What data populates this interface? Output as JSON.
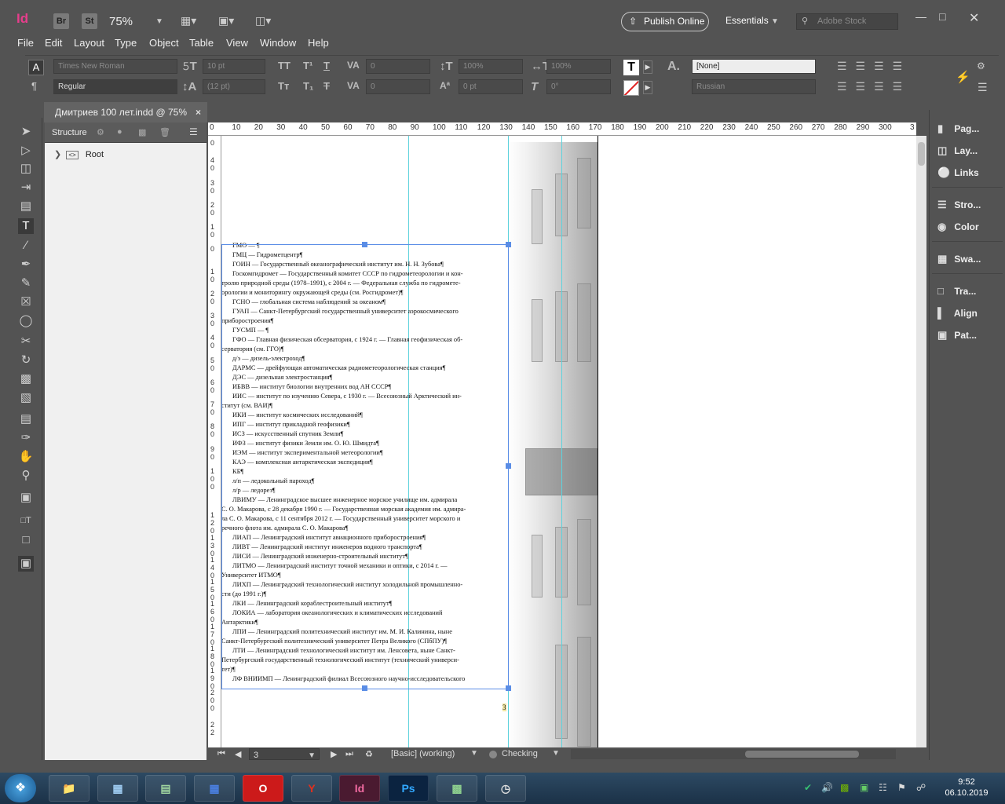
{
  "app": {
    "logo": "Id",
    "bridge": "Br",
    "stock": "St",
    "zoom": "75%",
    "publish": "Publish Online",
    "workspace": "Essentials",
    "search_placeholder": "Adobe Stock"
  },
  "menu": [
    "File",
    "Edit",
    "Layout",
    "Type",
    "Object",
    "Table",
    "View",
    "Window",
    "Help"
  ],
  "control": {
    "font_family": "Times New Roman",
    "font_style": "Regular",
    "font_size": "10 pt",
    "leading": "(12 pt)",
    "kerning": "0",
    "tracking": "0",
    "v_scale": "100%",
    "h_scale": "100%",
    "baseline": "0 pt",
    "skew": "0°",
    "char_style": "[None]",
    "language": "Russian"
  },
  "document_tab": {
    "title": "Дмитриев 100 лет.indd @ 75%",
    "close": "×"
  },
  "structure_panel": {
    "title": "Structure",
    "root": "Root"
  },
  "ruler_h": [
    "0",
    "10",
    "20",
    "30",
    "40",
    "50",
    "60",
    "70",
    "80",
    "90",
    "100",
    "110",
    "120",
    "130",
    "140",
    "150",
    "160",
    "170",
    "180",
    "190",
    "200",
    "210",
    "220",
    "230",
    "240",
    "250",
    "260",
    "270",
    "280",
    "290",
    "300",
    "3"
  ],
  "document_text": [
    {
      "t": "ГМО — ¶",
      "in": true
    },
    {
      "t": "ГМЦ — Гидрометцентр¶",
      "in": true
    },
    {
      "t": "ГОИН — Государственный океанографический институт им. Н. Н. Зубова¶",
      "in": true
    },
    {
      "t": "Госкомгидромет — Государственный комитет СССР по гидрометеорологии и кон-",
      "in": true
    },
    {
      "t": "тролю природной среды (1978–1991), с 2004 г. — Федеральная служба по гидромете-",
      "in": false
    },
    {
      "t": "орологии и мониторингу окружающей среды (см. Росгидромет)¶",
      "in": false
    },
    {
      "t": "ГСНО — глобальная система наблюдений за океаном¶",
      "in": true
    },
    {
      "t": "ГУАП — Санкт-Петербургский государственный университет аэрокосмического",
      "in": true
    },
    {
      "t": "приборостроения¶",
      "in": false
    },
    {
      "t": "ГУСМП — ¶",
      "in": true
    },
    {
      "t": "ГФО — Главная физическая обсерватория, с 1924 г. — Главная геофизическая об-",
      "in": true
    },
    {
      "t": "серватория (см. ГГО)¶",
      "in": false
    },
    {
      "t": "д/э — дизель-электроход¶",
      "in": true
    },
    {
      "t": "ДАРМС — дрейфующая автоматическая радиометеорологическая станция¶",
      "in": true
    },
    {
      "t": "ДЭС — дизельная электростанция¶",
      "in": true
    },
    {
      "t": "ИБВВ — институт биологии внутренних вод АН СССР¶",
      "in": true
    },
    {
      "t": "ИИС — институт по изучению Севера, с 1930 г. — Всесоюзный Арктический ин-",
      "in": true
    },
    {
      "t": "ститут (см. ВАИ)¶",
      "in": false
    },
    {
      "t": "ИКИ — институт космических исследований¶",
      "in": true
    },
    {
      "t": "ИПГ — институт прикладной геофизики¶",
      "in": true
    },
    {
      "t": "ИСЗ — искусственный спутник Земли¶",
      "in": true
    },
    {
      "t": "ИФЗ — институт физики Земли им. О. Ю. Шмидта¶",
      "in": true
    },
    {
      "t": "ИЭМ — институт экспериментальной метеорологии¶",
      "in": true
    },
    {
      "t": "КАЭ — комплексная антарктическая экспедиция¶",
      "in": true
    },
    {
      "t": "КБ¶",
      "in": true
    },
    {
      "t": "л/п — ледокольный пароход¶",
      "in": true
    },
    {
      "t": "л/р — ледорез¶",
      "in": true
    },
    {
      "t": "ЛВИМУ — Ленинградское высшее инженерное морское училище им. адмирала",
      "in": true
    },
    {
      "t": "С. О. Макарова, с 28 декабря 1990 г. — Государственная морская академия им. адмира-",
      "in": false
    },
    {
      "t": "ла С. О. Макарова, с 11 сентября 2012 г. — Государственный университет морского и",
      "in": false
    },
    {
      "t": "речного флота им. адмирала С. О. Макарова¶",
      "in": false
    },
    {
      "t": "ЛИАП — Ленинградский институт авиационного приборостроения¶",
      "in": true
    },
    {
      "t": "ЛИВТ — Ленинградский институт инженеров водного транспорта¶",
      "in": true
    },
    {
      "t": "ЛИСИ — Ленинградский инженерно-строительный институт¶",
      "in": true
    },
    {
      "t": "ЛИТМО — Ленинградский институт точной механики и оптики, с 2014 г. —",
      "in": true
    },
    {
      "t": "Университет ИТМО¶",
      "in": false
    },
    {
      "t": "ЛИХП — Ленинградский технологический институт холодильной промышленно-",
      "in": true
    },
    {
      "t": "сти (до 1991 г.)¶",
      "in": false
    },
    {
      "t": "ЛКИ — Ленинградский кораблестроительный институт¶",
      "in": true
    },
    {
      "t": "ЛОКИА — лаборатория океанологических и климатических исследований",
      "in": true
    },
    {
      "t": "Антарктики¶",
      "in": false
    },
    {
      "t": "ЛПИ — Ленинградский политехнический институт им. М. И. Калинина, ныне",
      "in": true
    },
    {
      "t": "Санкт-Петербургский политехнический университет Петра Великого (СПбПУ)¶",
      "in": false
    },
    {
      "t": "ЛТИ — Ленинградский технологический институт им. Ленсовета, ныне Санкт-",
      "in": true
    },
    {
      "t": "Петербургский государственный технологический институт (технический универси-",
      "in": false
    },
    {
      "t": "тет)¶",
      "in": false
    },
    {
      "t": "ЛФ ВНИИМП — Ленинградский филиал Всесоюзного научно-исследовательского",
      "in": true
    }
  ],
  "page_marker": "3",
  "status": {
    "page": "3",
    "preflight_profile": "[Basic] (working)",
    "preflight_status": "Checking"
  },
  "right_panels": [
    "Pag...",
    "Lay...",
    "Links",
    "Stro...",
    "Color",
    "Swa...",
    "Tra...",
    "Align",
    "Pat..."
  ],
  "clock": {
    "time": "9:52",
    "date": "06.10.2019"
  }
}
